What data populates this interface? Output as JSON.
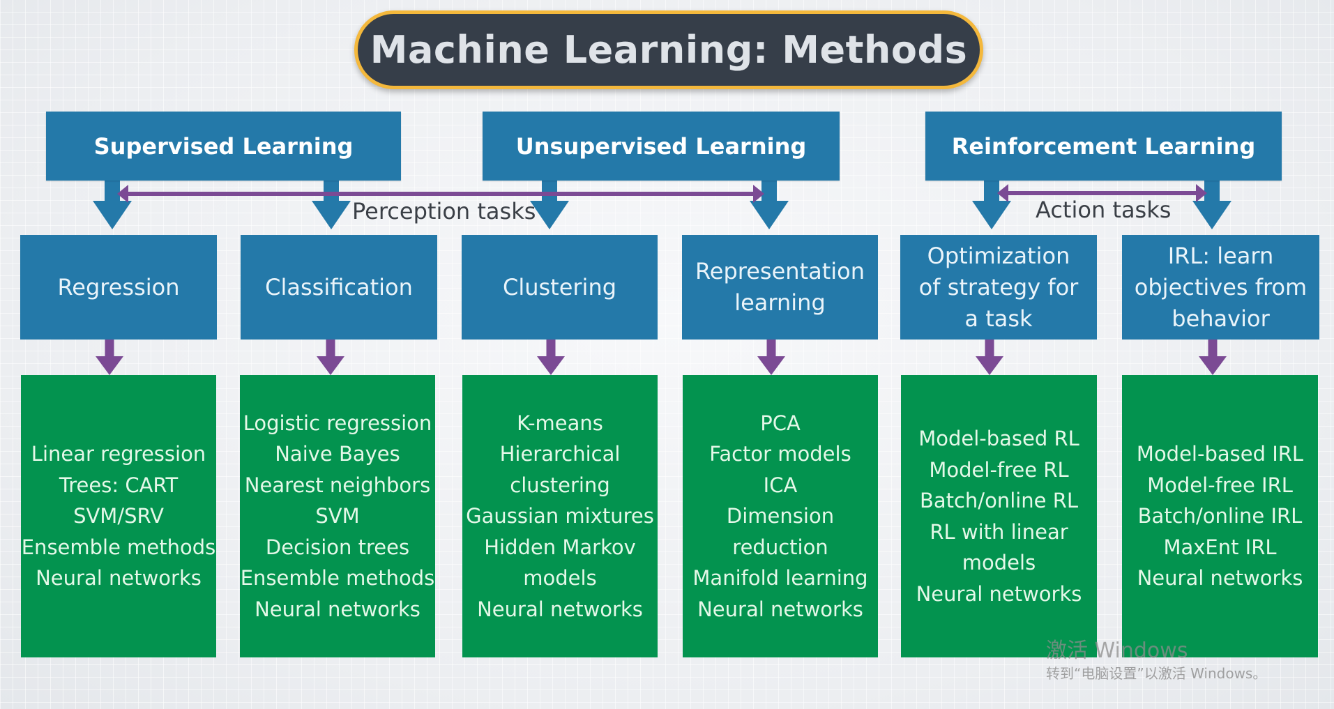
{
  "title": "Machine Learning: Methods",
  "colors": {
    "title_bg": "#363e49",
    "title_border": "#f4b83c",
    "category_blue": "#2479a9",
    "method_green": "#03934f",
    "relation_purple": "#7b4a94"
  },
  "categories": [
    {
      "label": "Supervised Learning"
    },
    {
      "label": "Unsupervised Learning"
    },
    {
      "label": "Reinforcement Learning"
    }
  ],
  "relations": [
    {
      "label": "Perception tasks"
    },
    {
      "label": "Action tasks"
    }
  ],
  "tasks": [
    {
      "label": "Regression",
      "methods": [
        "Linear regression",
        "Trees: CART",
        "SVM/SRV",
        "Ensemble methods",
        "Neural networks"
      ]
    },
    {
      "label": "Classification",
      "methods": [
        "Logistic regression",
        "Naive Bayes",
        "Nearest neighbors",
        "SVM",
        "Decision trees",
        "Ensemble methods",
        "Neural networks"
      ]
    },
    {
      "label": "Clustering",
      "methods": [
        "K-means",
        "Hierarchical",
        "clustering",
        "Gaussian mixtures",
        "Hidden Markov",
        "models",
        "Neural networks"
      ]
    },
    {
      "label": "Representation\nlearning",
      "methods": [
        "PCA",
        "Factor models",
        "ICA",
        "Dimension",
        "reduction",
        "Manifold learning",
        "Neural networks"
      ]
    },
    {
      "label": "Optimization\nof strategy for\na task",
      "methods": [
        "Model-based RL",
        "Model-free RL",
        "Batch/online RL",
        "RL with linear",
        "models",
        "Neural networks"
      ]
    },
    {
      "label": "IRL: learn\nobjectives from\nbehavior",
      "methods": [
        "Model-based IRL",
        "Model-free IRL",
        "Batch/online IRL",
        "MaxEnt IRL",
        "Neural networks"
      ]
    }
  ],
  "watermark": {
    "line1": "激活 Windows",
    "line2": "转到“电脑设置”以激活 Windows。"
  }
}
